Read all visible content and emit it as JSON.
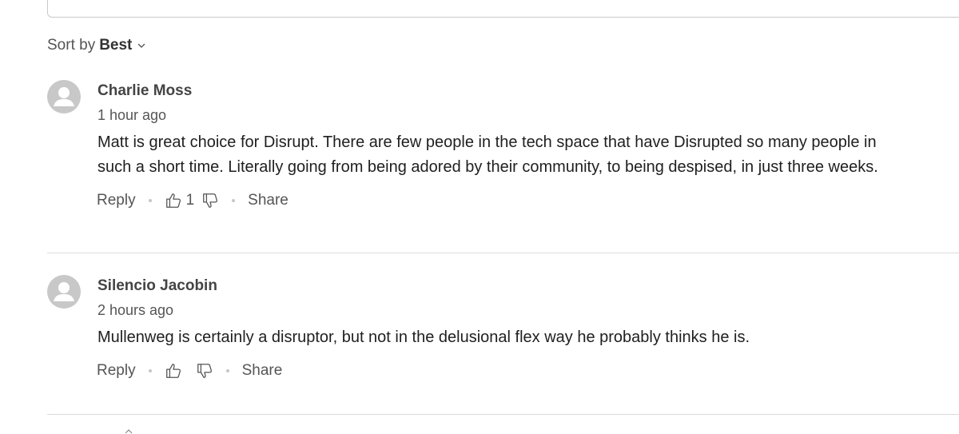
{
  "sort": {
    "prefix": "Sort by",
    "value": "Best"
  },
  "comments": [
    {
      "author": "Charlie Moss",
      "time": "1 hour ago",
      "text": "Matt is great choice for Disrupt. There are few people in the tech space that have Disrupted so many people in such a short time. Literally going from being adored by their community, to being despised, in just three weeks.",
      "reply_label": "Reply",
      "upvotes": "1",
      "share_label": "Share"
    },
    {
      "author": "Silencio Jacobin",
      "time": "2 hours ago",
      "text": "Mullenweg is certainly a disruptor, but not in the delusional flex way he probably thinks he is.",
      "reply_label": "Reply",
      "upvotes": "",
      "share_label": "Share"
    }
  ],
  "colors": {
    "text": "#1f1f1f",
    "muted": "#555555",
    "divider": "#dcdcdc",
    "avatar": "#c8c8c8"
  }
}
